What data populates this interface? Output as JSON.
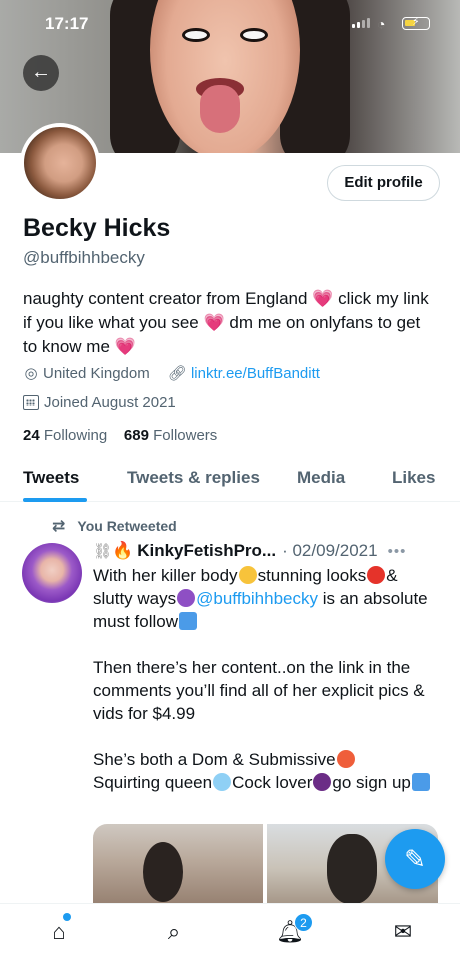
{
  "status_bar": {
    "time": "17:17"
  },
  "profile": {
    "edit_label": "Edit profile",
    "name": "Becky Hicks",
    "handle": "@buffbihhbecky",
    "bio_parts": [
      "naughty content creator from England ",
      " click my link if you like what you see ",
      " dm me on onlyfans to get to know me "
    ],
    "location": "United Kingdom",
    "link": "linktr.ee/BuffBanditt",
    "joined": "Joined August 2021",
    "following_count": "24",
    "following_label": "Following",
    "followers_count": "689",
    "followers_label": "Followers"
  },
  "tabs": [
    "Tweets",
    "Tweets & replies",
    "Media",
    "Likes"
  ],
  "tweet": {
    "retweet_label": "You Retweeted",
    "author": "KinkyFetishPro...",
    "date": "· 02/09/2021",
    "line1a": "With her killer body",
    "line1b": "stunning looks",
    "line1c": "&",
    "line2a": "slutty ways",
    "mention": "@buffbihhbecky",
    "line2b": " is an absolute must follow",
    "para2": "Then there’s her content..on the link in the comments you’ll find all of her explicit pics & vids for $4.99",
    "para3a": "She’s both a Dom & Submissive",
    "para3b": "Squirting queen",
    "para3c": "Cock lover",
    "para3d": "go sign up"
  },
  "bottom_nav": {
    "notification_count": "2"
  },
  "colors": {
    "accent": "#1d9bf0",
    "text": "#0f1419",
    "muted": "#536471"
  }
}
